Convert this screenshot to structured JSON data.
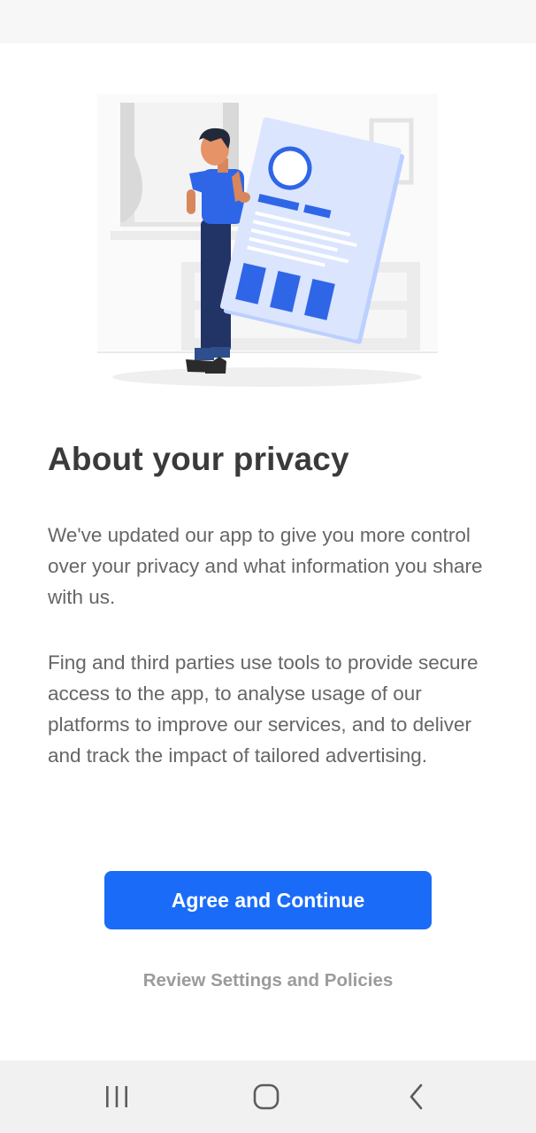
{
  "privacy": {
    "title": "About your privacy",
    "paragraph_1": "We've updated our app to give you more control over your privacy and what information you share with us.",
    "paragraph_2": "Fing and third parties use tools to provide secure access to the app, to analyse usage of our platforms to improve our services, and to deliver and track the impact of tailored advertising.",
    "agree_label": "Agree and Continue",
    "review_label": "Review Settings and Policies"
  },
  "illustration": {
    "icon": "person-holding-document-illustration"
  },
  "nav": {
    "recents_icon": "recents-icon",
    "home_icon": "home-icon",
    "back_icon": "back-icon"
  },
  "colors": {
    "accent": "#1a6cf8",
    "title": "#3a3a3a",
    "body_text": "#666666",
    "link": "#9b9b9b",
    "illustration_blue": "#2f66e8"
  }
}
